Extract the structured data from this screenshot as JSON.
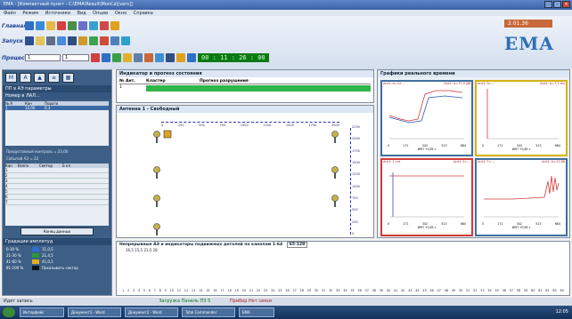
{
  "window": {
    "title": "EMA - [Компактный пункт - C:\\EMA\\Result\\MonCa\\[vers]]",
    "btn_min": "_",
    "btn_max": "□",
    "btn_close": "×"
  },
  "menu": [
    "Файл",
    "Режим",
    "Источники",
    "Вид",
    "Опции",
    "Окно",
    "Справка"
  ],
  "toolbar": {
    "row1_label": "Главная",
    "row2_label": "Запуск",
    "row3_label": "Процесс",
    "combo1": "1",
    "combo2": "1",
    "clock": "00 : 11 : 26 : 00"
  },
  "logo": {
    "time": "2.01.36",
    "text": "EMA"
  },
  "left": {
    "tab1": "М",
    "tab2": "А",
    "heading": "ПП в АЭ параметры",
    "sub1": "Номер в ЛАЛ...",
    "grid_headers": [
      "№ А",
      "Кан",
      "Пороги"
    ],
    "grid_row": [
      "1",
      "10,00",
      "0.3"
    ],
    "info1": "Предуставный контроль = 23,00",
    "info2": "Событий АЭ = 22",
    "list_headers": [
      "Кан",
      "Всего",
      "Сектор",
      "Б кл"
    ],
    "list_rows": [
      "1",
      "2",
      "3",
      "4",
      "5",
      "6",
      "7"
    ],
    "btn_cleanup": "Конец данных",
    "legend_title": "Градации амплитуд",
    "legend": [
      {
        "range": "0-10 %",
        "val": "11,0,5",
        "color": "#2c6fd1"
      },
      {
        "range": "21-30 %",
        "val": "21,4,5",
        "color": "#2a9a3a"
      },
      {
        "range": "41-60 %",
        "val": "41,0,5",
        "color": "#e0b020"
      },
      {
        "range": "81-100 %",
        "val": "Показывать сектор",
        "color": "#111111"
      }
    ]
  },
  "indicator": {
    "title": "Индикатор и прогноз состояния",
    "cols": [
      "№ Ант.",
      "Кластер",
      "Прогноз разрушения"
    ],
    "row_num": "1"
  },
  "antenna": {
    "title": "Антенна 1 - Свободный",
    "ruler": [
      "0",
      "250",
      "500",
      "750",
      "1000",
      "1250",
      "1500",
      "1750",
      "2000"
    ],
    "yscale": [
      "2250",
      "2000",
      "1750",
      "1500",
      "1250",
      "1000",
      "750",
      "500",
      "250",
      "0"
    ]
  },
  "graphs": {
    "title": "Графики реального времени",
    "plots": [
      {
        "l": "Ant1: A=12...",
        "r": "Ant1: A=71,5 Дб",
        "border": "#3f6f9f"
      },
      {
        "l": "Ant1: A=...",
        "r": "Ant1: A=7,1 ms",
        "border": "#d4b414"
      },
      {
        "l": "Ant1: 1 cnt",
        "r": "Ant1: E=...",
        "border": "#d23a3a"
      },
      {
        "l": "Ant1: T=...",
        "r": "Ant1: A=17,86",
        "border": "#3f6f9f"
      }
    ],
    "xticks": [
      "0",
      "171",
      "342",
      "513",
      "684"
    ],
    "xlabel": "ИНП +0,65 с"
  },
  "bottom": {
    "title": "Непрерывные АЭ и индикаторы подвижных деталей по каналам 1-64",
    "range": "65-128",
    "nums": "16,5  15,5  21,5  28",
    "channels": [
      "1",
      "2",
      "3",
      "4",
      "5",
      "6",
      "7",
      "8",
      "9",
      "10",
      "11",
      "12",
      "13",
      "14",
      "15",
      "16",
      "17",
      "18",
      "19",
      "20",
      "21",
      "22",
      "23",
      "24",
      "25",
      "26",
      "27",
      "28",
      "29",
      "30",
      "31",
      "32",
      "33",
      "34",
      "35",
      "36",
      "37",
      "38",
      "39",
      "40",
      "41",
      "42",
      "43",
      "44",
      "45",
      "46",
      "47",
      "48",
      "49",
      "50",
      "51",
      "52",
      "53",
      "54",
      "55",
      "56",
      "57",
      "58",
      "59",
      "60",
      "61",
      "62",
      "63",
      "64"
    ]
  },
  "status": {
    "left": "Идет запись",
    "mid1": "Загрузка Панель ПЗ 5",
    "mid2": "Прибор Нет связи"
  },
  "taskbar": [
    "Интерфейс",
    "Документ1 - Word",
    "Документ2 - Word",
    "Total Commander",
    "EMA"
  ],
  "tray": {
    "time": "12:05"
  }
}
